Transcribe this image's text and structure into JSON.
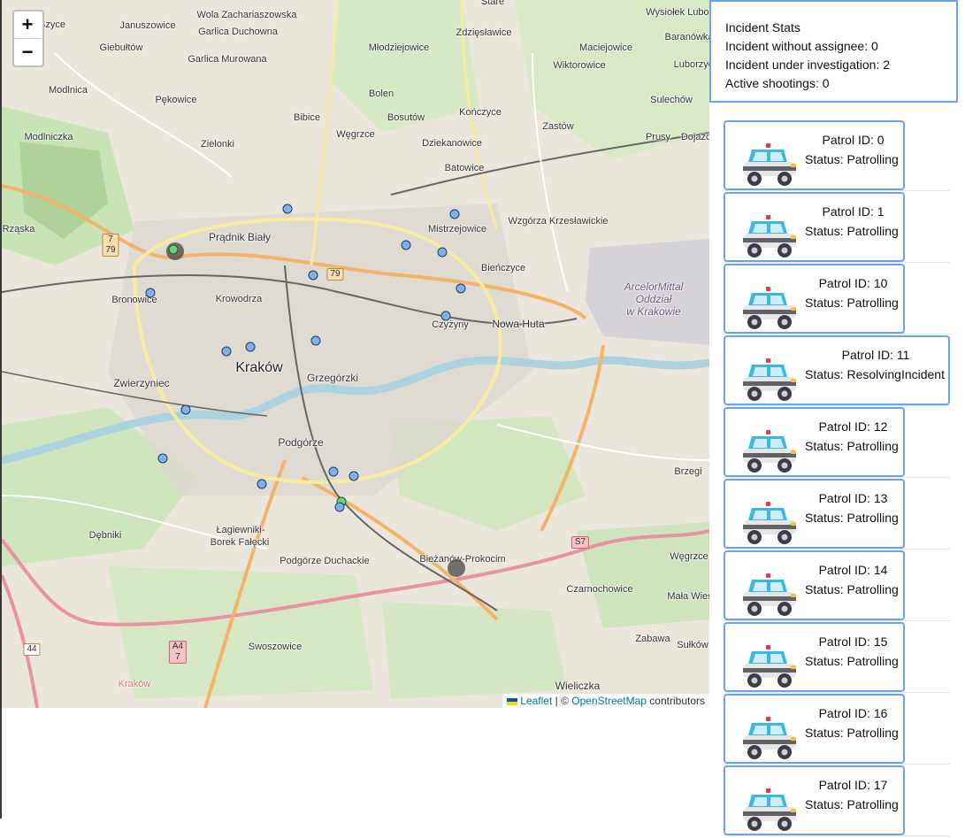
{
  "map": {
    "zoom_in_label": "+",
    "zoom_out_label": "−",
    "attribution": {
      "leaflet": "Leaflet",
      "separator": " | © ",
      "osm": "OpenStreetMap",
      "contributors": " contributors"
    },
    "places": [
      {
        "name": "Szyce"
      },
      {
        "name": "Januszowice"
      },
      {
        "name": "Wola Zachariaszowska"
      },
      {
        "name": "Garlica Duchowna"
      },
      {
        "name": "Giebułtów"
      },
      {
        "name": "Garlica Murowana"
      },
      {
        "name": "Zdzięsławice"
      },
      {
        "name": "Młodziejowice"
      },
      {
        "name": "Maciejowice"
      },
      {
        "name": "Wysiołek Luborzycki"
      },
      {
        "name": "Baranówka"
      },
      {
        "name": "Wiktorowice"
      },
      {
        "name": "Luborzyca"
      },
      {
        "name": "Bibice"
      },
      {
        "name": "Bolen"
      },
      {
        "name": "Bosutów"
      },
      {
        "name": "Kończyce"
      },
      {
        "name": "Zastów"
      },
      {
        "name": "Sulechów"
      },
      {
        "name": "Modlnica"
      },
      {
        "name": "Pękowice"
      },
      {
        "name": "Modlniczka"
      },
      {
        "name": "Zielonki"
      },
      {
        "name": "Węgrzce"
      },
      {
        "name": "Dziekanowice"
      },
      {
        "name": "Prusy"
      },
      {
        "name": "Batowice"
      },
      {
        "name": "Wzgórza Krzesławickie"
      },
      {
        "name": "Mistrzejowice"
      },
      {
        "name": "Rząska"
      },
      {
        "name": "Prądnik Biały"
      },
      {
        "name": "Bieńczyce"
      },
      {
        "name": "Bronowice"
      },
      {
        "name": "Krowodrza"
      },
      {
        "name": "Czyżyny"
      },
      {
        "name": "Nowa Huta"
      },
      {
        "name": "Kraków"
      },
      {
        "name": "Grzegórzki"
      },
      {
        "name": "Zwierzyniec"
      },
      {
        "name": "Podgórze"
      },
      {
        "name": "Brzegi"
      },
      {
        "name": "Dębniki"
      },
      {
        "name": "Łagiewniki-"
      },
      {
        "name": "Borek Fałęcki"
      },
      {
        "name": "Podgórze Duchackie"
      },
      {
        "name": "Bieżanów-Prokocim"
      },
      {
        "name": "Węgrzce"
      },
      {
        "name": "Czarnochowice"
      },
      {
        "name": "Mała Wieś"
      },
      {
        "name": "Swoszowice"
      },
      {
        "name": "Zabawa"
      },
      {
        "name": "Sułków"
      },
      {
        "name": "Wieliczka"
      },
      {
        "name": "Kraków"
      },
      {
        "name": "Stare"
      },
      {
        "name": "Dojazdów"
      }
    ],
    "steelworks_label": [
      "ArcelorMittal",
      "Oddział",
      "w Krakowie"
    ],
    "road_shields": [
      {
        "label": "7\n79"
      },
      {
        "label": "79"
      },
      {
        "label": "S7"
      },
      {
        "label": "44"
      },
      {
        "label": "A4\n7"
      }
    ]
  },
  "stats": {
    "title": "Incident Stats",
    "without_assignee": "Incident without assignee: 0",
    "under_investigation": "Incident under investigation: 2",
    "active_shootings": "Active shootings: 0"
  },
  "patrols": [
    {
      "id_label": "Patrol ID: 0",
      "status_label": "Status: Patrolling"
    },
    {
      "id_label": "Patrol ID: 1",
      "status_label": "Status: Patrolling"
    },
    {
      "id_label": "Patrol ID: 10",
      "status_label": "Status: Patrolling"
    },
    {
      "id_label": "Patrol ID: 11",
      "status_label": "Status: ResolvingIncident"
    },
    {
      "id_label": "Patrol ID: 12",
      "status_label": "Status: Patrolling"
    },
    {
      "id_label": "Patrol ID: 13",
      "status_label": "Status: Patrolling"
    },
    {
      "id_label": "Patrol ID: 14",
      "status_label": "Status: Patrolling"
    },
    {
      "id_label": "Patrol ID: 15",
      "status_label": "Status: Patrolling"
    },
    {
      "id_label": "Patrol ID: 16",
      "status_label": "Status: Patrolling"
    },
    {
      "id_label": "Patrol ID: 17",
      "status_label": "Status: Patrolling"
    }
  ],
  "colors": {
    "accent": "#6aa4ec",
    "patrol_marker": "#7fb0e8",
    "incident_marker": "#6dd07a"
  }
}
